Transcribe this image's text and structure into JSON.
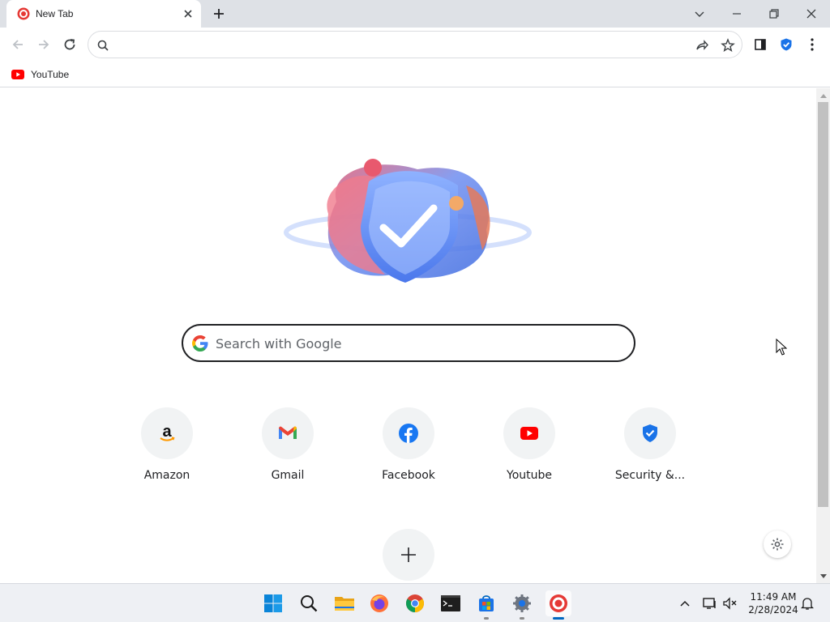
{
  "tab": {
    "title": "New Tab",
    "favicon": "browser-logo-icon"
  },
  "window_controls": [
    "tab-search-icon",
    "minimize-icon",
    "restore-icon",
    "close-icon"
  ],
  "toolbar": {
    "omnibox_value": "",
    "icons": [
      "back-arrow-icon",
      "forward-arrow-icon",
      "reload-icon",
      "search-icon",
      "share-icon",
      "star-icon",
      "side-panel-icon",
      "security-extension-icon",
      "kebab-menu-icon"
    ]
  },
  "bookmarks": [
    {
      "label": "YouTube",
      "icon": "youtube-icon"
    }
  ],
  "search": {
    "placeholder": "Search with Google"
  },
  "shortcuts": [
    {
      "label": "Amazon",
      "icon": "amazon-icon"
    },
    {
      "label": "Gmail",
      "icon": "gmail-icon"
    },
    {
      "label": "Facebook",
      "icon": "facebook-icon"
    },
    {
      "label": "Youtube",
      "icon": "youtube-icon"
    },
    {
      "label": "Security &...",
      "icon": "shield-check-icon"
    }
  ],
  "taskbar": {
    "apps": [
      "windows-start-icon",
      "search-icon",
      "file-explorer-icon",
      "firefox-icon",
      "chrome-icon",
      "terminal-icon",
      "store-icon",
      "settings-icon",
      "browser-logo-icon"
    ],
    "time": "11:49 AM",
    "date": "2/28/2024"
  },
  "colors": {
    "accent": "#1a73e8",
    "brand_red": "#e53935",
    "tabstrip": "#dee1e6",
    "taskbar": "#eef0f4"
  }
}
